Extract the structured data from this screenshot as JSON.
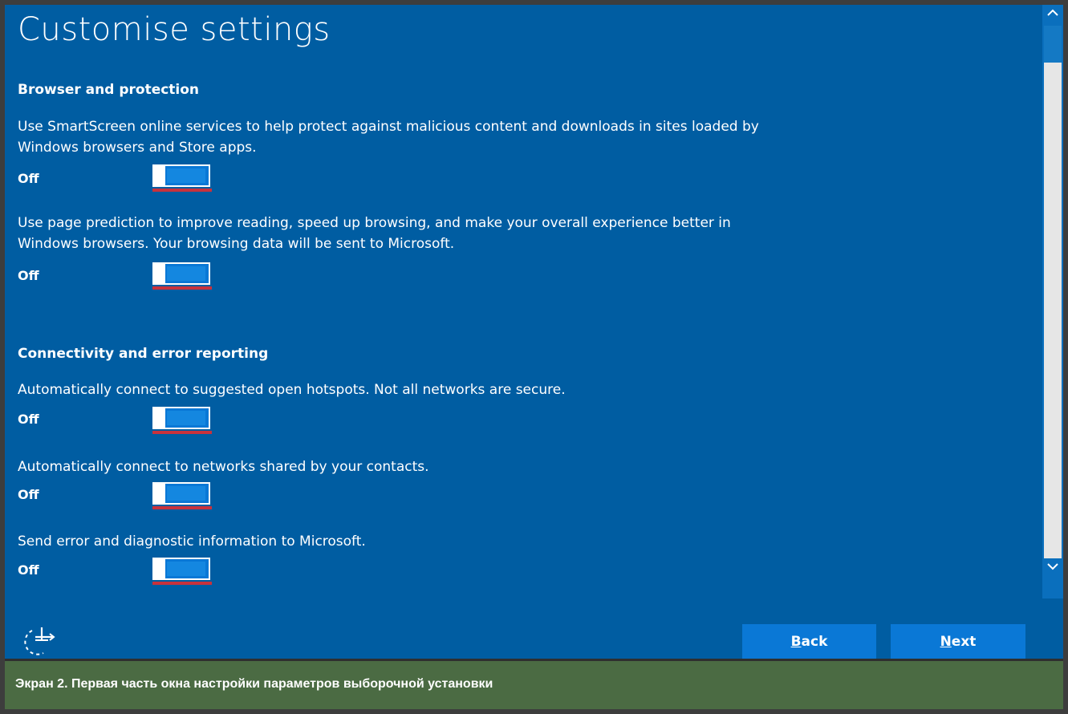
{
  "title": "Customise settings",
  "sections": [
    {
      "heading": "Browser and protection",
      "settings": [
        {
          "description": "Use SmartScreen online services to help protect against malicious content and downloads in sites loaded by Windows browsers and Store apps.",
          "state": "Off"
        },
        {
          "description": "Use page prediction to improve reading, speed up browsing, and make your overall experience better in Windows browsers. Your browsing data will be sent to Microsoft.",
          "state": "Off"
        }
      ]
    },
    {
      "heading": "Connectivity and error reporting",
      "settings": [
        {
          "description": "Automatically connect to suggested open hotspots. Not all networks are secure.",
          "state": "Off"
        },
        {
          "description": "Automatically connect to networks shared by your contacts.",
          "state": "Off"
        },
        {
          "description": "Send error and diagnostic information to Microsoft.",
          "state": "Off"
        }
      ]
    }
  ],
  "buttons": {
    "back_access_key": "B",
    "back_rest": "ack",
    "next_access_key": "N",
    "next_rest": "ext"
  },
  "caption": "Экран 2. Первая часть окна настройки параметров выборочной установки",
  "colors": {
    "background": "#005da2",
    "toggle_track": "#0a78d6",
    "focus_underline": "#c8323c",
    "caption_bar": "#4b6b43"
  },
  "icons": {
    "ease_of_access": "ease-of-access-icon",
    "scroll_up": "chevron-up-icon",
    "scroll_down": "chevron-down-icon"
  }
}
